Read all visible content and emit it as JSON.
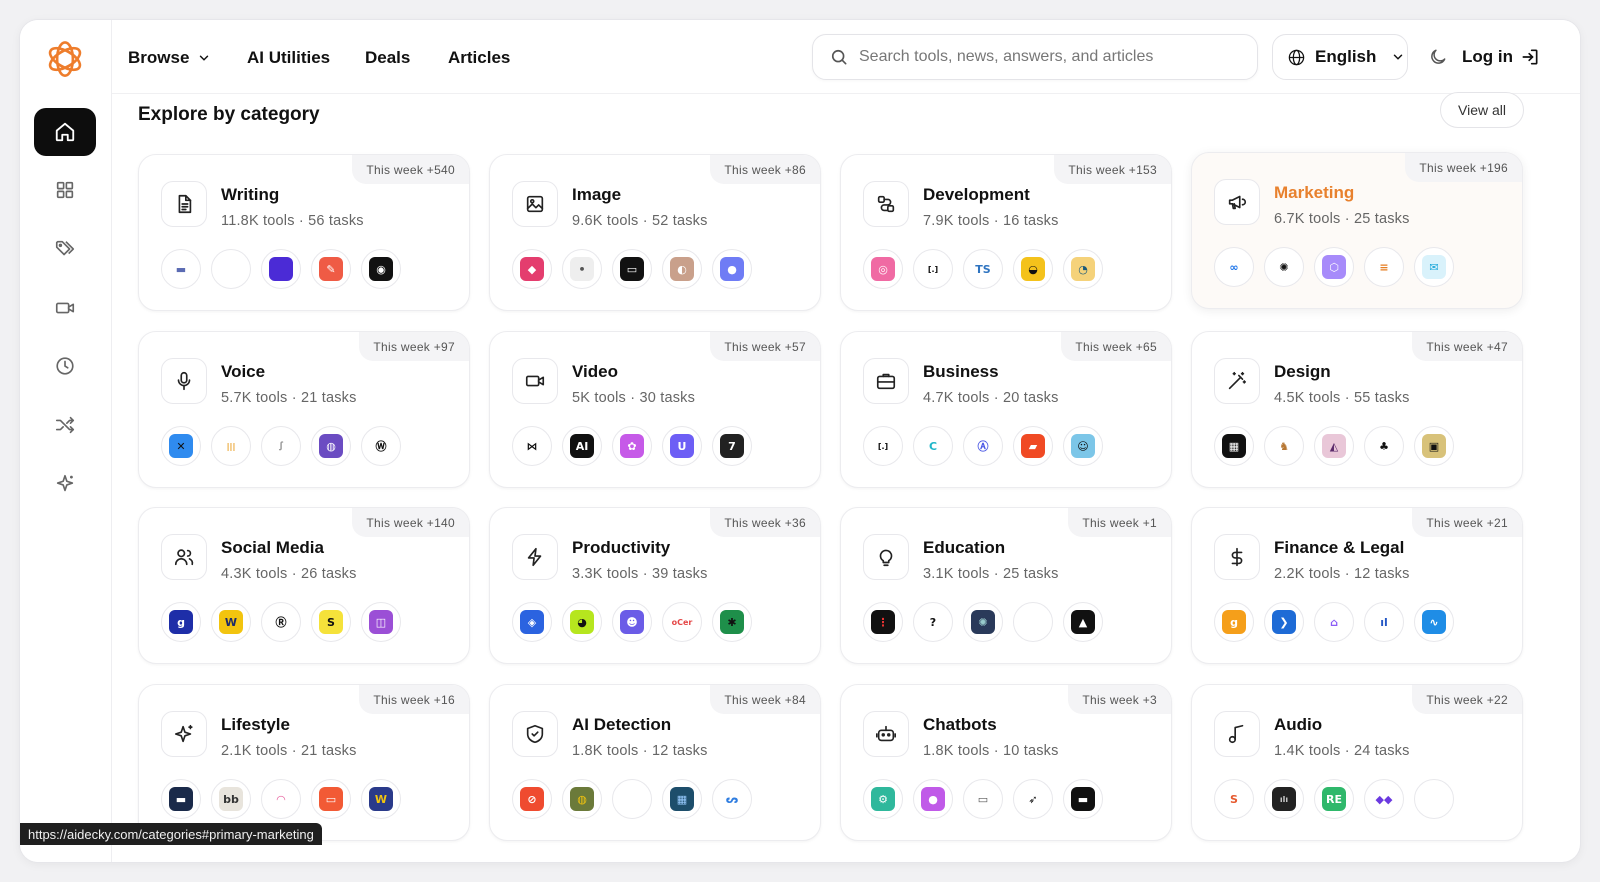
{
  "nav": {
    "browse": "Browse",
    "utilities": "AI Utilities",
    "deals": "Deals",
    "articles": "Articles",
    "search_placeholder": "Search tools, news, answers, and articles",
    "language": "English",
    "login": "Log in"
  },
  "section": {
    "title": "Explore by category",
    "view_all": "View all"
  },
  "categories": [
    {
      "name": "Writing",
      "meta": "11.8K tools · 56 tasks",
      "week": "This week +540",
      "icon": "document-icon",
      "tools": [
        {
          "bg": "#ffffff",
          "fg": "#5b6bb3",
          "t": "▬"
        },
        {
          "bg": "#ffffff",
          "fg": "#fff",
          "t": ""
        },
        {
          "bg": "#4b2bd6",
          "fg": "#fff",
          "t": ""
        },
        {
          "bg": "#ef5b45",
          "fg": "#fff",
          "t": "✎"
        },
        {
          "bg": "#111111",
          "fg": "#fff",
          "t": "◉"
        }
      ]
    },
    {
      "name": "Image",
      "meta": "9.6K tools · 52 tasks",
      "week": "This week +86",
      "icon": "image-icon",
      "tools": [
        {
          "bg": "#e43d6e",
          "fg": "#fff",
          "t": "◆"
        },
        {
          "bg": "#eeeeee",
          "fg": "#555",
          "t": "•"
        },
        {
          "bg": "#111111",
          "fg": "#fff",
          "t": "▭"
        },
        {
          "bg": "#c9a08b",
          "fg": "#fff",
          "t": "◐"
        },
        {
          "bg": "#6f7cf5",
          "fg": "#fff",
          "t": "●"
        }
      ]
    },
    {
      "name": "Development",
      "meta": "7.9K tools · 16 tasks",
      "week": "This week +153",
      "icon": "route-icon",
      "tools": [
        {
          "bg": "#f06aa3",
          "fg": "#fff",
          "t": "◎"
        },
        {
          "bg": "#ffffff",
          "fg": "#111",
          "t": "[.]"
        },
        {
          "bg": "#ffffff",
          "fg": "#2f74c0",
          "t": "TS"
        },
        {
          "bg": "#f4c21b",
          "fg": "#111",
          "t": "◒"
        },
        {
          "bg": "#f5d27a",
          "fg": "#1b5a7a",
          "t": "◔"
        }
      ]
    },
    {
      "name": "Marketing",
      "meta": "6.7K tools · 25 tasks",
      "week": "This week +196",
      "icon": "megaphone-icon",
      "highlight": true,
      "tools": [
        {
          "bg": "#ffffff",
          "fg": "#1a73e8",
          "t": "∞"
        },
        {
          "bg": "#ffffff",
          "fg": "#111",
          "t": "✺"
        },
        {
          "bg": "#a78bfa",
          "fg": "#fff",
          "t": "⬡"
        },
        {
          "bg": "#ffffff",
          "fg": "#e67e22",
          "t": "≡"
        },
        {
          "bg": "#d9f2fb",
          "fg": "#1aa6d8",
          "t": "✉"
        }
      ]
    },
    {
      "name": "Voice",
      "meta": "5.7K tools · 21 tasks",
      "week": "This week +97",
      "icon": "microphone-icon",
      "tools": [
        {
          "bg": "#2f8bef",
          "fg": "#111",
          "t": "✕"
        },
        {
          "bg": "#ffffff",
          "fg": "#e89a1a",
          "t": "|||"
        },
        {
          "bg": "#ffffff",
          "fg": "#999",
          "t": "ꭍ"
        },
        {
          "bg": "#6b4cc2",
          "fg": "#fff",
          "t": "◍"
        },
        {
          "bg": "#ffffff",
          "fg": "#111",
          "t": "Ⓦ"
        }
      ]
    },
    {
      "name": "Video",
      "meta": "5K tools · 30 tasks",
      "week": "This week +57",
      "icon": "video-icon",
      "tools": [
        {
          "bg": "#ffffff",
          "fg": "#111",
          "t": "⋈"
        },
        {
          "bg": "#111111",
          "fg": "#fff",
          "t": "AI"
        },
        {
          "bg": "#c65ae8",
          "fg": "#fff",
          "t": "✿"
        },
        {
          "bg": "#6d5ef5",
          "fg": "#fff",
          "t": "U"
        },
        {
          "bg": "#222222",
          "fg": "#fff",
          "t": "7"
        }
      ]
    },
    {
      "name": "Business",
      "meta": "4.7K tools · 20 tasks",
      "week": "This week +65",
      "icon": "briefcase-icon",
      "tools": [
        {
          "bg": "#ffffff",
          "fg": "#111",
          "t": "[.]"
        },
        {
          "bg": "#ffffff",
          "fg": "#21b6c9",
          "t": "C"
        },
        {
          "bg": "#ffffff",
          "fg": "#4b58e5",
          "t": "Ⓐ"
        },
        {
          "bg": "#f04a24",
          "fg": "#fff",
          "t": "▰"
        },
        {
          "bg": "#7cc6e8",
          "fg": "#111",
          "t": "☺"
        }
      ]
    },
    {
      "name": "Design",
      "meta": "4.5K tools · 55 tasks",
      "week": "This week +47",
      "icon": "wand-icon",
      "tools": [
        {
          "bg": "#111111",
          "fg": "#fff",
          "t": "▦"
        },
        {
          "bg": "#ffffff",
          "fg": "#b77733",
          "t": "♞"
        },
        {
          "bg": "#e9c7d8",
          "fg": "#5b2a6b",
          "t": "◭"
        },
        {
          "bg": "#ffffff",
          "fg": "#111",
          "t": "♣"
        },
        {
          "bg": "#d8c27a",
          "fg": "#111",
          "t": "▣"
        }
      ]
    },
    {
      "name": "Social Media",
      "meta": "4.3K tools · 26 tasks",
      "week": "This week +140",
      "icon": "users-icon",
      "tools": [
        {
          "bg": "#1e2ea8",
          "fg": "#fff",
          "t": "g"
        },
        {
          "bg": "#f2c40f",
          "fg": "#1b2a6b",
          "t": "W"
        },
        {
          "bg": "#ffffff",
          "fg": "#111",
          "t": "Ⓡ"
        },
        {
          "bg": "#f5e23a",
          "fg": "#111",
          "t": "S"
        },
        {
          "bg": "#9b4fd6",
          "fg": "#fff",
          "t": "◫"
        }
      ]
    },
    {
      "name": "Productivity",
      "meta": "3.3K tools · 39 tasks",
      "week": "This week +36",
      "icon": "bolt-icon",
      "tools": [
        {
          "bg": "#2b63e0",
          "fg": "#fff",
          "t": "◈"
        },
        {
          "bg": "#b6e61e",
          "fg": "#111",
          "t": "◕"
        },
        {
          "bg": "#6b5ce7",
          "fg": "#fff",
          "t": "☻"
        },
        {
          "bg": "#ffffff",
          "fg": "#e54848",
          "t": "oCer"
        },
        {
          "bg": "#1e8f4a",
          "fg": "#111",
          "t": "✱"
        }
      ]
    },
    {
      "name": "Education",
      "meta": "3.1K tools · 25 tasks",
      "week": "This week +1",
      "icon": "lightbulb-icon",
      "tools": [
        {
          "bg": "#111111",
          "fg": "#e33",
          "t": "⋮"
        },
        {
          "bg": "#ffffff",
          "fg": "#111",
          "t": "?"
        },
        {
          "bg": "#2a3a5a",
          "fg": "#9cc",
          "t": "✺"
        },
        {
          "bg": "#ffffff",
          "fg": "#fff",
          "t": ""
        },
        {
          "bg": "#111111",
          "fg": "#fff",
          "t": "▲"
        }
      ]
    },
    {
      "name": "Finance & Legal",
      "meta": "2.2K tools · 12 tasks",
      "week": "This week +21",
      "icon": "dollar-icon",
      "tools": [
        {
          "bg": "#f59f1a",
          "fg": "#fff",
          "t": "g"
        },
        {
          "bg": "#1e6bd6",
          "fg": "#fff",
          "t": "❯"
        },
        {
          "bg": "#ffffff",
          "fg": "#8b5cf6",
          "t": "⌂"
        },
        {
          "bg": "#ffffff",
          "fg": "#2457c5",
          "t": "ıl"
        },
        {
          "bg": "#1f8de6",
          "fg": "#fff",
          "t": "∿"
        }
      ]
    },
    {
      "name": "Lifestyle",
      "meta": "2.1K tools · 21 tasks",
      "week": "This week +16",
      "icon": "sparkles-icon",
      "tools": [
        {
          "bg": "#1a2a4a",
          "fg": "#fff",
          "t": "▬"
        },
        {
          "bg": "#e8e4dc",
          "fg": "#333",
          "t": "bb"
        },
        {
          "bg": "#ffffff",
          "fg": "#e65a9a",
          "t": "◠"
        },
        {
          "bg": "#f25a35",
          "fg": "#fff",
          "t": "▭"
        },
        {
          "bg": "#2a3a8a",
          "fg": "#f2c40f",
          "t": "W"
        }
      ]
    },
    {
      "name": "AI Detection",
      "meta": "1.8K tools · 12 tasks",
      "week": "This week +84",
      "icon": "shield-icon",
      "tools": [
        {
          "bg": "#ef4b2f",
          "fg": "#fff",
          "t": "⊘"
        },
        {
          "bg": "#6b7a3a",
          "fg": "#f2c40f",
          "t": "◍"
        },
        {
          "bg": "#ffffff",
          "fg": "#fff",
          "t": ""
        },
        {
          "bg": "#1d4e6b",
          "fg": "#9cf",
          "t": "▦"
        },
        {
          "bg": "#ffffff",
          "fg": "#2f7de0",
          "t": "ᔕ"
        }
      ]
    },
    {
      "name": "Chatbots",
      "meta": "1.8K tools · 10 tasks",
      "week": "This week +3",
      "icon": "robot-icon",
      "tools": [
        {
          "bg": "#2fb89c",
          "fg": "#fff",
          "t": "⚙"
        },
        {
          "bg": "#c05ae8",
          "fg": "#fff",
          "t": "●"
        },
        {
          "bg": "#ffffff",
          "fg": "#555",
          "t": "▭"
        },
        {
          "bg": "#ffffff",
          "fg": "#111",
          "t": "➶"
        },
        {
          "bg": "#111111",
          "fg": "#fff",
          "t": "▬"
        }
      ]
    },
    {
      "name": "Audio",
      "meta": "1.4K tools · 24 tasks",
      "week": "This week +22",
      "icon": "music-note-icon",
      "tools": [
        {
          "bg": "#ffffff",
          "fg": "#e65a2f",
          "t": "S"
        },
        {
          "bg": "#222222",
          "fg": "#ccc",
          "t": "ılı"
        },
        {
          "bg": "#2fb86b",
          "fg": "#fff",
          "t": "RE"
        },
        {
          "bg": "#ffffff",
          "fg": "#6b3ae0",
          "t": "◆◆"
        },
        {
          "bg": "#ffffff",
          "fg": "#fff",
          "t": ""
        }
      ]
    }
  ],
  "status_url": "https://aidecky.com/categories#primary-marketing"
}
